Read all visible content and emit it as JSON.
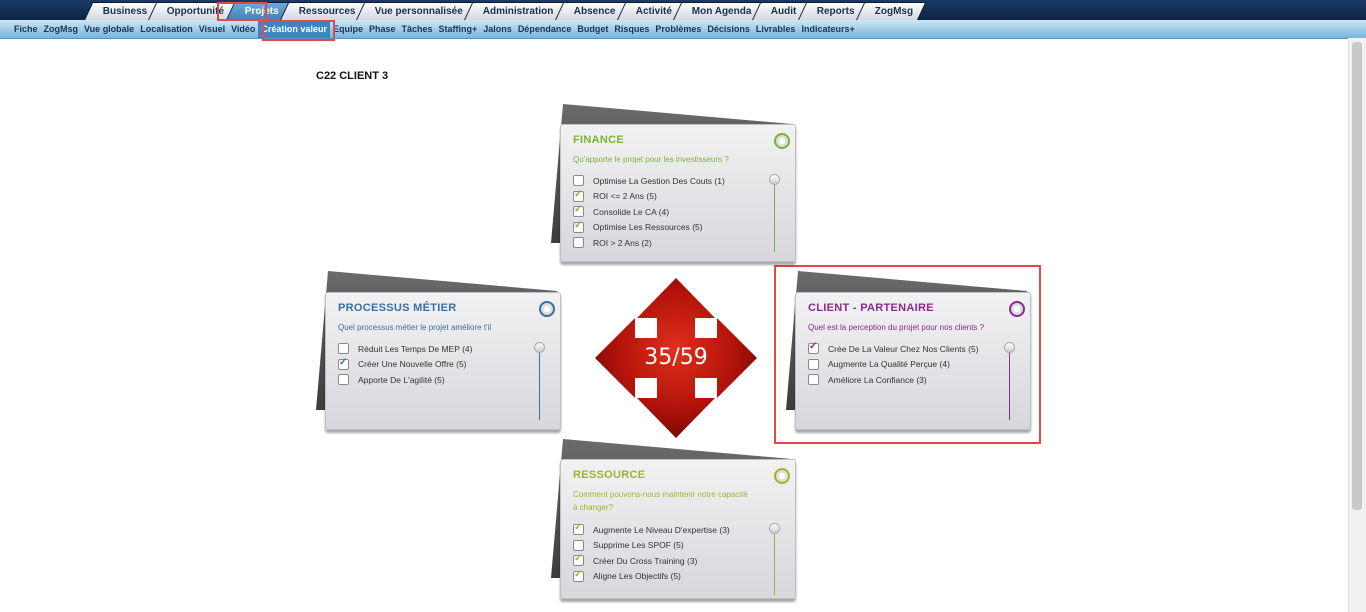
{
  "top_nav": [
    "Business",
    "Opportunité",
    "Projets",
    "Ressources",
    "Vue personnalisée",
    "Administration",
    "Absence",
    "Activité",
    "Mon Agenda",
    "Audit",
    "Reports",
    "ZogMsg"
  ],
  "top_nav_active": "Projets",
  "sub_nav": [
    "Fiche",
    "ZogMsg",
    "Vue globale",
    "Localisation",
    "Visuel",
    "Vidéo",
    "Création valeur",
    "Equipe",
    "Phase",
    "Tâches",
    "Staffing+",
    "Jalons",
    "Dépendance",
    "Budget",
    "Risques",
    "Problèmes",
    "Décisions",
    "Livrables",
    "Indicateurs+"
  ],
  "sub_nav_active": "Création valeur",
  "project_title": "C22 CLIENT 3",
  "score": "35/59",
  "cards": {
    "finance": {
      "title": "FINANCE",
      "question": "Qu'apporte le projet pour les investisseurs ?",
      "color": "#7ab52e",
      "items": [
        {
          "label": "Optimise La Gestion Des Couts (1)",
          "checked": false
        },
        {
          "label": "ROI <= 2 Ans (5)",
          "checked": true
        },
        {
          "label": "Consolide Le CA (4)",
          "checked": true
        },
        {
          "label": "Optimise Les Ressources (5)",
          "checked": true
        },
        {
          "label": "ROI > 2 Ans (2)",
          "checked": false
        }
      ]
    },
    "processus": {
      "title": "PROCESSUS MÉTIER",
      "question": "Quel processus métier le projet améliore t'il",
      "color": "#3a6fa0",
      "items": [
        {
          "label": "Réduit Les Temps De MEP (4)",
          "checked": false
        },
        {
          "label": "Créer Une Nouvelle Offre (5)",
          "checked": true
        },
        {
          "label": "Apporte De L'agilité (5)",
          "checked": false
        }
      ]
    },
    "client": {
      "title": "CLIENT - PARTENAIRE",
      "question": "Quel est la perception du projet pour nos clients ?",
      "color": "#8a2a8a",
      "items": [
        {
          "label": "Crée De La Valeur Chez Nos Clients (5)",
          "checked": true
        },
        {
          "label": "Augmente La Qualité Perçue (4)",
          "checked": false
        },
        {
          "label": "Améliore La Confiance (3)",
          "checked": false
        }
      ]
    },
    "ressource": {
      "title": "RESSOURCE",
      "question": "Comment pouvons-nous maintenir notre capacité à changer?",
      "color": "#a3b22a",
      "items": [
        {
          "label": "Augmente Le Niveau D'expertise (3)",
          "checked": true
        },
        {
          "label": "Supprime Les SPOF (5)",
          "checked": false
        },
        {
          "label": "Créer Du Cross Training (3)",
          "checked": true
        },
        {
          "label": "Aligne Les Objectifs (5)",
          "checked": true
        }
      ]
    }
  }
}
